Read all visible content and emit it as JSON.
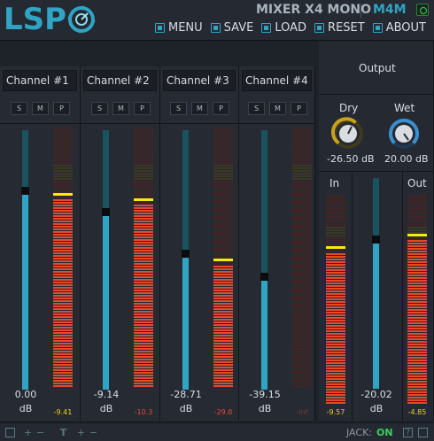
{
  "header": {
    "logo_text": "LSP",
    "plugin_name": "MIXER X4 MONO",
    "plugin_short": "M4M",
    "menu": [
      {
        "label": "MENU",
        "icon": "menu-icon"
      },
      {
        "label": "SAVE",
        "icon": "save-icon"
      },
      {
        "label": "LOAD",
        "icon": "load-icon"
      },
      {
        "label": "RESET",
        "icon": "reset-icon"
      },
      {
        "label": "ABOUT",
        "icon": "about-icon"
      }
    ]
  },
  "channels": [
    {
      "name": "Channel #1",
      "solo": "S",
      "mute": "M",
      "phase": "P",
      "gain": "0.00",
      "unit": "dB",
      "peak": "-9.41",
      "fader": 0.75,
      "meter": 0.73
    },
    {
      "name": "Channel #2",
      "solo": "S",
      "mute": "M",
      "phase": "P",
      "gain": "-9.14",
      "unit": "dB",
      "peak": "-10.3",
      "fader": 0.67,
      "meter": 0.71
    },
    {
      "name": "Channel #3",
      "solo": "S",
      "mute": "M",
      "phase": "P",
      "gain": "-28.71",
      "unit": "dB",
      "peak": "-29.8",
      "fader": 0.51,
      "meter": 0.48
    },
    {
      "name": "Channel #4",
      "solo": "S",
      "mute": "M",
      "phase": "P",
      "gain": "-39.15",
      "unit": "dB",
      "peak": "-inf",
      "fader": 0.42,
      "meter": 0.0
    }
  ],
  "output": {
    "title": "Output",
    "dry": {
      "label": "Dry",
      "value": "-26.50 dB"
    },
    "wet": {
      "label": "Wet",
      "value": "20.00 dB"
    },
    "in_label": "In",
    "out_label": "Out",
    "gain": "-20.02",
    "unit": "dB",
    "in_peak": "-9.57",
    "out_peak": "-4.85",
    "fader": 0.69,
    "in_meter": 0.73,
    "out_meter": 0.79
  },
  "footer": {
    "jack_label": "JACK:",
    "jack_state": "ON"
  },
  "colors": {
    "accent": "#2fa4c4",
    "meter_red": "#e8482c",
    "meter_yellow": "#c9c23a",
    "peak_yellow": "#f0f000",
    "dry_knob": "#c9a21a",
    "wet_knob": "#3a8fd0"
  }
}
